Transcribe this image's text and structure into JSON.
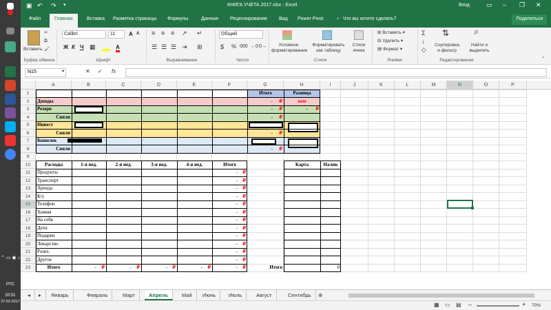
{
  "taskbar": {
    "lang": "РУС",
    "time": "20:51",
    "date": "27.02.2017"
  },
  "app": {
    "title": "КНИГА УЧЕТА 2017.xlsx - Excel",
    "login": "Вход",
    "share": "Поделиться",
    "tell_me": "Что вы хотите сделать?"
  },
  "ribbon_tabs": [
    "Файл",
    "Главная",
    "Вставка",
    "Разметка страницы",
    "Формулы",
    "Данные",
    "Рецензирование",
    "Вид",
    "Power Pivot"
  ],
  "ribbon": {
    "paste": "Вставить",
    "clipboard": "Буфер обмена",
    "font_name": "Calibri",
    "font_size": "11",
    "font": "Шрифт",
    "bold": "Ж",
    "italic": "К",
    "underline": "Ч",
    "grow": "A",
    "shrink": "A",
    "alignment": "Выравнивание",
    "number_format": "Общий",
    "number": "Число",
    "percent": "%",
    "thousands": "000",
    "cond1": "Условное",
    "cond2": "форматирование",
    "fmt_table1": "Форматировать",
    "fmt_table2": "как таблицу",
    "styles1": "Стили",
    "styles2": "ячеек",
    "styles": "Стили",
    "insert": "Вставить",
    "delete": "Удалить",
    "format": "Формат",
    "cells": "Ячейки",
    "sort1": "Сортировка",
    "sort2": "и фильтр",
    "find1": "Найти и",
    "find2": "выделить",
    "editing": "Редактирование"
  },
  "formula_bar": {
    "name_box": "N15",
    "value": ""
  },
  "columns": [
    "A",
    "B",
    "C",
    "D",
    "E",
    "F",
    "G",
    "H",
    "I",
    "J",
    "K",
    "L",
    "M",
    "N",
    "O",
    "P"
  ],
  "rows": [
    "1",
    "2",
    "3",
    "4",
    "5",
    "6",
    "7",
    "8",
    "9",
    "10",
    "11",
    "12",
    "13",
    "14",
    "15",
    "16",
    "17",
    "18",
    "19",
    "20",
    "21",
    "22",
    "23"
  ],
  "summary": {
    "header_itogo": "Итого",
    "header_raznica": "Разница",
    "dohody": "Доходы",
    "rezerv": "Резерв",
    "snyali": "Сняли",
    "invest": "Инвест",
    "koshelek": "Кошелек",
    "dash": "-",
    "rub": "₽",
    "net": "нет"
  },
  "table": {
    "headers": [
      "Расходы",
      "1-я нед.",
      "2-я нед.",
      "3-я нед.",
      "4-я нед.",
      "Итого"
    ],
    "items": [
      "Продукты",
      "Транспорт",
      "Аренда",
      "К/у",
      "Телефон",
      "Химия",
      "На себя",
      "Дети",
      "Подарки",
      "Лекарство",
      "Развл.",
      "Другое"
    ],
    "total_label": "Итого",
    "dash": "-",
    "rub": "₽"
  },
  "side_table": {
    "karta": "Карта",
    "nalik": "Налик",
    "itogo": "Итого",
    "total_value": "0"
  },
  "sheet_tabs": [
    "Январь",
    "Февраль",
    "Март",
    "Апрель",
    "Май",
    "Июнь",
    "Июль",
    "Август",
    "Сентябрь"
  ],
  "active_sheet": "Апрель",
  "zoom": "70%",
  "colors": {
    "excel_green": "#217346",
    "pink": "#f4cccc",
    "green_fill": "#c6e0b4",
    "yellow_fill": "#ffe699",
    "blue_fill": "#dde9f5",
    "header_blue": "#b4c6e7",
    "header_pink": "#f4b6c2",
    "red": "#ff0000"
  }
}
